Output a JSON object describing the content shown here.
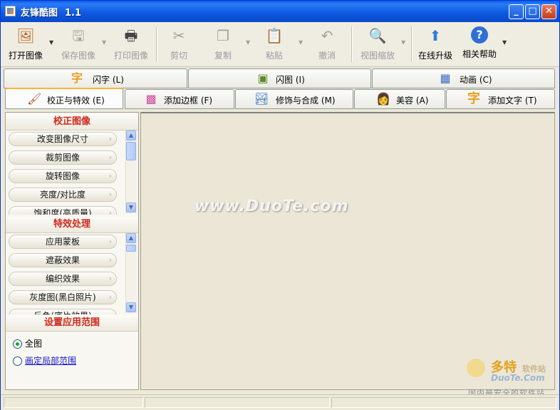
{
  "window": {
    "title": "友锋酷图",
    "version": "1.1"
  },
  "toolbar": {
    "items": [
      {
        "label": "打开图像",
        "icon": "open-image-icon",
        "enabled": true,
        "dropdown": true
      },
      {
        "label": "保存图像",
        "icon": "save-image-icon",
        "enabled": false,
        "dropdown": true
      },
      {
        "label": "打印图像",
        "icon": "print-icon",
        "enabled": false
      },
      {
        "label": "剪切",
        "icon": "scissors-icon",
        "enabled": false
      },
      {
        "label": "复制",
        "icon": "copy-icon",
        "enabled": false,
        "dropdown": true
      },
      {
        "label": "粘贴",
        "icon": "paste-icon",
        "enabled": false,
        "dropdown": true
      },
      {
        "label": "撤消",
        "icon": "undo-icon",
        "enabled": false
      },
      {
        "label": "视图缩放",
        "icon": "zoom-icon",
        "enabled": false,
        "dropdown": true
      },
      {
        "label": "在线升级",
        "icon": "upgrade-icon",
        "enabled": true
      },
      {
        "label": "相关帮助",
        "icon": "help-icon",
        "enabled": true,
        "dropdown": true
      }
    ]
  },
  "tabs_row1": [
    {
      "label": "闪字",
      "key": "(L)",
      "icon": "flash-text-icon"
    },
    {
      "label": "闪图",
      "key": "(I)",
      "icon": "flash-image-icon"
    },
    {
      "label": "动画",
      "key": "(C)",
      "icon": "animation-icon"
    }
  ],
  "tabs_row2": [
    {
      "label": "校正与特效",
      "key": "(E)",
      "icon": "correct-effects-icon",
      "active": true
    },
    {
      "label": "添加边框",
      "key": "(F)",
      "icon": "border-icon"
    },
    {
      "label": "修饰与合成",
      "key": "(M)",
      "icon": "compose-icon"
    },
    {
      "label": "美容",
      "key": "(A)",
      "icon": "beauty-icon"
    },
    {
      "label": "添加文字",
      "key": "(T)",
      "icon": "add-text-icon"
    }
  ],
  "panel": {
    "correct": {
      "title": "校正图像",
      "items": [
        "改变图像尺寸",
        "裁剪图像",
        "旋转图像",
        "亮度/对比度",
        "饱和度(高质量)"
      ]
    },
    "effects": {
      "title": "特效处理",
      "items": [
        "应用蒙板",
        "遮蔽效果",
        "编织效果",
        "灰度图(黑白照片)",
        "反色(底片效果)"
      ]
    },
    "scope": {
      "title": "设置应用范围",
      "options": [
        {
          "label": "全图",
          "selected": true
        },
        {
          "label": "画定局部范围",
          "selected": false
        }
      ]
    }
  },
  "watermark": {
    "text": "www.DuoTe.com"
  },
  "corner_logo": {
    "big": "多特",
    "small": "软件站",
    "url": "DuoTe.Com",
    "tagline": "国内最安全的软件站"
  },
  "colors": {
    "titlebar": "#0a5fe9",
    "section_title": "#d0271a",
    "tab_active_top": "#f8b43a",
    "canvas": "#ebe6d6"
  }
}
